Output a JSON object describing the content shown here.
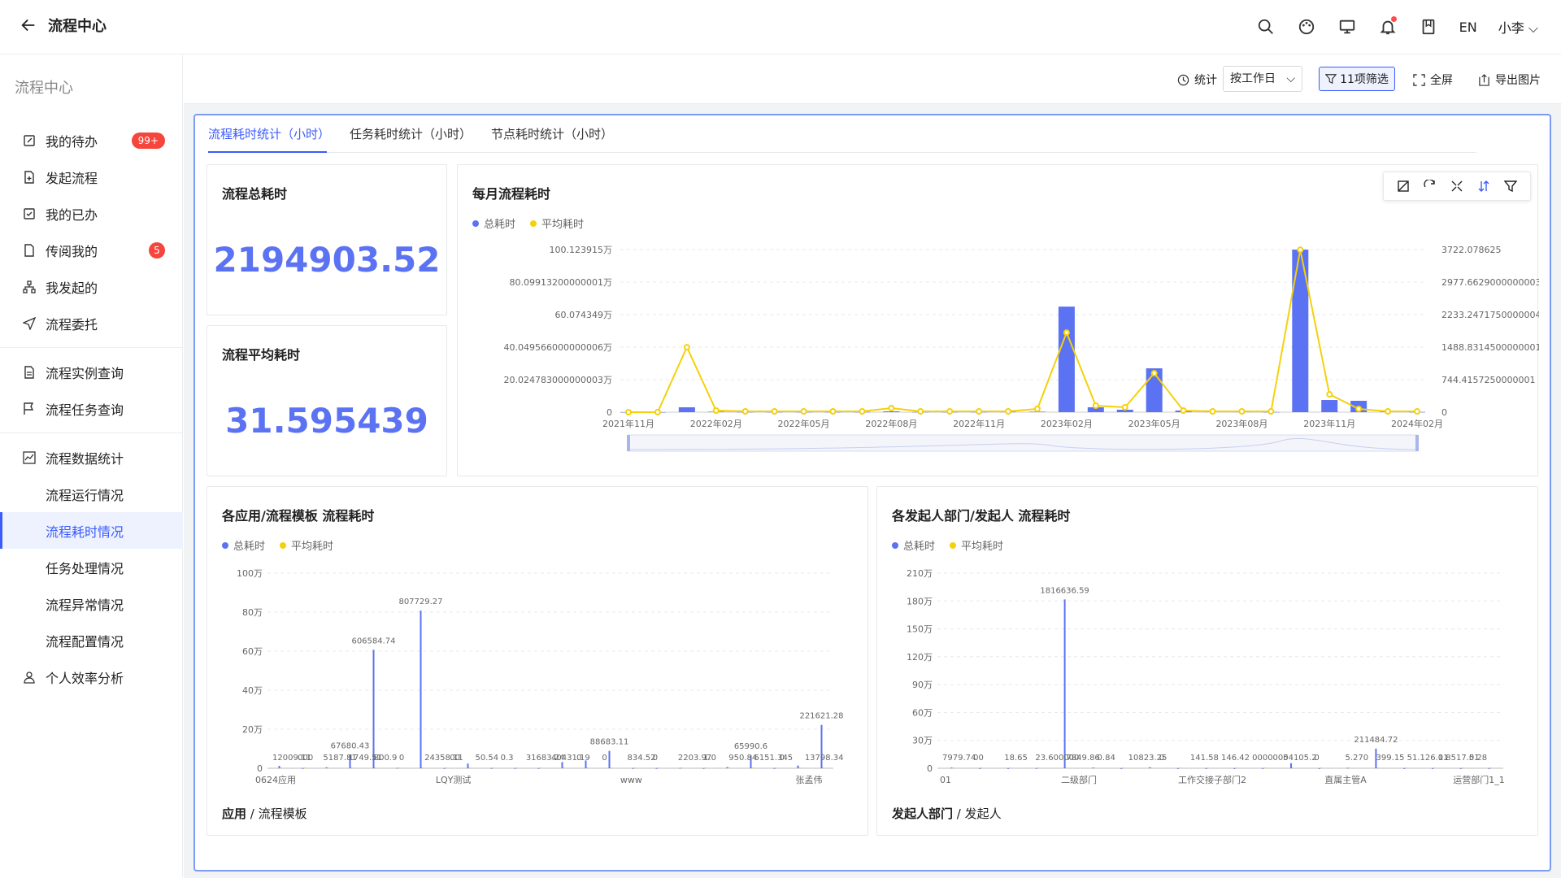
{
  "header": {
    "title": "流程中心",
    "lang": "EN",
    "user": "小李"
  },
  "sidebar": {
    "title": "流程中心",
    "items": [
      {
        "label": "我的待办",
        "badge": "99+"
      },
      {
        "label": "发起流程"
      },
      {
        "label": "我的已办"
      },
      {
        "label": "传阅我的",
        "badge": "5"
      },
      {
        "label": "我发起的"
      },
      {
        "label": "流程委托"
      },
      {
        "label": "流程实例查询"
      },
      {
        "label": "流程任务查询"
      },
      {
        "label": "流程数据统计"
      },
      {
        "label": "流程运行情况"
      },
      {
        "label": "流程耗时情况"
      },
      {
        "label": "任务处理情况"
      },
      {
        "label": "流程异常情况"
      },
      {
        "label": "流程配置情况"
      },
      {
        "label": "个人效率分析"
      }
    ]
  },
  "toolbar": {
    "stat_label": "统计",
    "period": "按工作日",
    "filter": "11项筛选",
    "fullscreen": "全屏",
    "export": "导出图片"
  },
  "tabs": [
    "流程耗时统计（小时）",
    "任务耗时统计（小时）",
    "节点耗时统计（小时）"
  ],
  "kpi": {
    "total_title": "流程总耗时",
    "total_value": "2194903.52",
    "avg_title": "流程平均耗时",
    "avg_value": "31.595439"
  },
  "colors": {
    "primary": "#5b72f2",
    "accent": "#3b5bfd",
    "yellow": "#f5d10b",
    "badge": "#f5453c"
  },
  "legend": {
    "total": "总耗时",
    "avg": "平均耗时"
  },
  "chart_data": [
    {
      "type": "bar+line",
      "title": "每月流程耗时",
      "left_ticks": [
        "0",
        "20.024783000000003万",
        "40.049566000000006万",
        "60.074349万",
        "80.09913200000001万",
        "100.123915万"
      ],
      "right_ticks": [
        "0",
        "744.4157250000001",
        "1488.8314500000001",
        "2233.2471750000004",
        "2977.6629000000003",
        "3722.078625"
      ],
      "x_tick_labels": [
        "2021年11月",
        "2022年02月",
        "2022年05月",
        "2022年08月",
        "2022年11月",
        "2023年02月",
        "2023年05月",
        "2023年08月",
        "2023年11月",
        "2024年02月"
      ],
      "x": [
        "2021-11",
        "2021-12",
        "2022-01",
        "2022-02",
        "2022-03",
        "2022-04",
        "2022-05",
        "2022-06",
        "2022-07",
        "2022-08",
        "2022-09",
        "2022-10",
        "2022-11",
        "2022-12",
        "2023-01",
        "2023-02",
        "2023-03",
        "2023-04",
        "2023-05",
        "2023-06",
        "2023-07",
        "2023-08",
        "2023-09",
        "2023-10",
        "2023-11",
        "2023-12",
        "2024-01",
        "2024-02"
      ],
      "series": [
        {
          "name": "总耗时",
          "axis": "left",
          "unit": "万",
          "values": [
            0,
            0,
            3.0,
            0.3,
            0.1,
            0.1,
            0.1,
            0.1,
            0.1,
            0.5,
            0.1,
            0.1,
            0.1,
            0.2,
            0.3,
            65.0,
            3.0,
            1.5,
            27.0,
            1.0,
            0.5,
            0.2,
            0.1,
            100.1,
            7.5,
            7.0,
            0.3,
            0.1
          ]
        },
        {
          "name": "平均耗时",
          "axis": "left_scaled",
          "values": [
            0,
            0,
            40.0,
            1.0,
            0.5,
            0.5,
            0.5,
            0.5,
            0.5,
            2.5,
            0.5,
            0.5,
            0.5,
            0.5,
            2.0,
            49.0,
            4.0,
            3.0,
            24.0,
            1.0,
            0.5,
            0.5,
            0.5,
            100.0,
            11.0,
            2.0,
            0.5,
            0.5
          ]
        }
      ],
      "ylim": [
        0,
        100.123915
      ]
    },
    {
      "type": "bar",
      "title": "各应用/流程模板 流程耗时",
      "xlabel_bold": "应用",
      "xlabel": "流程模板",
      "y_ticks": [
        "0",
        "20万",
        "40万",
        "60万",
        "80万",
        "100万"
      ],
      "x_tick_labels": [
        "0624应用",
        "LQY测试",
        "www",
        "张孟伟"
      ],
      "data_labels": [
        "12009.11",
        "000",
        "5187.81",
        "1749.51",
        "800.9",
        "0",
        "24358.11",
        "00",
        "50.54",
        "0.3",
        "31683.24",
        "40431.19",
        "0",
        "0",
        "834.52",
        "0",
        "2203.97",
        "1.0",
        "950.84",
        "6151.345",
        "0",
        "13798.34",
        "67680.43",
        "606584.74",
        "807729.27",
        "88683.11",
        "65990.6",
        "221621.28"
      ],
      "values": [
        1.2,
        0.1,
        0.5,
        6.8,
        60.7,
        0.2,
        80.8,
        0.1,
        2.4,
        0.1,
        0.1,
        0.1,
        3.2,
        4.0,
        8.9,
        0.1,
        0.1,
        0.2,
        0.1,
        0.6,
        6.6,
        0.1,
        1.4,
        22.2
      ],
      "ylim": [
        0,
        100
      ]
    },
    {
      "type": "bar",
      "title": "各发起人部门/发起人 流程耗时",
      "xlabel_bold": "发起人部门",
      "xlabel": "发起人",
      "y_ticks": [
        "0",
        "30万",
        "60万",
        "90万",
        "120万",
        "150万",
        "180万",
        "210万"
      ],
      "x_tick_labels": [
        "01",
        "二级部门",
        "工作交接子部门2",
        "直属主管A",
        "运营部门1_1"
      ],
      "data_labels": [
        "7979.74",
        "00",
        "18.65",
        "23.600000",
        "7849.86",
        "0.84",
        "10823.25",
        "0",
        "141.58",
        "146.42",
        "0000000",
        "54105.2",
        "0",
        "5.270",
        "399.15",
        "51.126.11",
        "0.8517.51",
        "0.28",
        "1816636.59",
        "211484.72"
      ],
      "values": [
        0.8,
        0.1,
        0.1,
        0.2,
        181.7,
        0.8,
        0.1,
        1.1,
        0.1,
        0.1,
        0.1,
        0.1,
        5.4,
        0.1,
        0.5,
        21.1,
        0.1,
        0.1,
        0.1,
        0.1
      ],
      "ylim": [
        0,
        210
      ]
    }
  ]
}
